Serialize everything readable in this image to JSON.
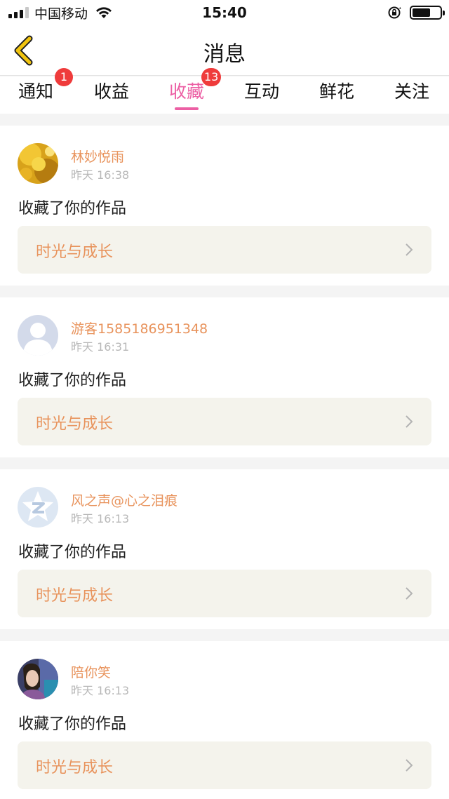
{
  "status_bar": {
    "carrier": "中国移动",
    "time": "15:40",
    "signal_bars_filled": 3,
    "battery_fraction": 0.65
  },
  "nav": {
    "title": "消息",
    "back_icon": "chevron-left-icon",
    "accent": "#f1c40f"
  },
  "tabs": [
    {
      "label": "通知",
      "badge": "1",
      "active": false
    },
    {
      "label": "收益",
      "badge": "",
      "active": false
    },
    {
      "label": "收藏",
      "badge": "13",
      "active": true
    },
    {
      "label": "互动",
      "badge": "",
      "active": false
    },
    {
      "label": "鲜花",
      "badge": "",
      "active": false
    },
    {
      "label": "关注",
      "badge": "",
      "active": false
    }
  ],
  "colors": {
    "active_tab": "#ec5fa4",
    "badge": "#ef3b3b",
    "username": "#e8935c",
    "work_card_bg": "#f4f3ec"
  },
  "messages": [
    {
      "username": "林妙悦雨",
      "time": "昨天 16:38",
      "action": "收藏了你的作品",
      "work_title": "时光与成长",
      "avatar": "sunflower-photo"
    },
    {
      "username": "游客1585186951348",
      "time": "昨天 16:31",
      "action": "收藏了你的作品",
      "work_title": "时光与成长",
      "avatar": "default-person-icon"
    },
    {
      "username": "风之声@心之泪痕",
      "time": "昨天 16:13",
      "action": "收藏了你的作品",
      "work_title": "时光与成长",
      "avatar": "qq-star-icon"
    },
    {
      "username": "陪你笑",
      "time": "昨天 16:13",
      "action": "收藏了你的作品",
      "work_title": "时光与成长",
      "avatar": "selfie-photo"
    }
  ]
}
